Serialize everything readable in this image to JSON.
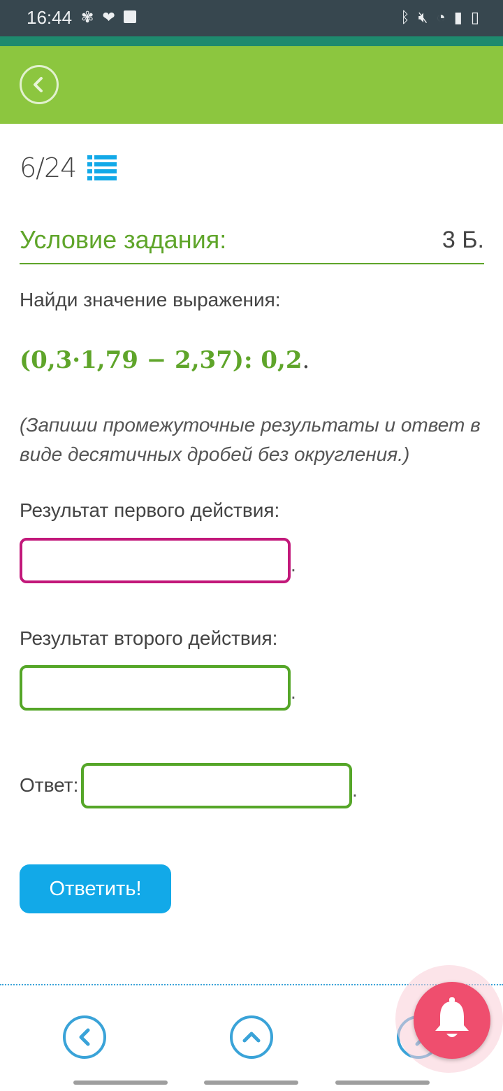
{
  "status_bar": {
    "time": "16:44",
    "left_icons": [
      "fan-icon",
      "heart-icon",
      "checkbox-icon"
    ],
    "right_icons": [
      "bluetooth-icon",
      "mute-icon",
      "wifi-icon",
      "signal-icon",
      "battery-icon"
    ]
  },
  "header": {
    "back_icon": "chevron-left-icon",
    "background": "#8cc63f"
  },
  "progress": {
    "counter": "6/24",
    "list_icon": "list-icon"
  },
  "task": {
    "title": "Условие задания:",
    "points": "3 Б.",
    "prompt": "Найди значение выражения:",
    "expression": "(0,3·1,79 − 2,37): 0,2",
    "expression_end": ".",
    "note": "(Запиши промежуточные результаты и ответ в виде десятичных дробей без округления.)",
    "step1_label": "Результат первого действия:",
    "step1_value": "",
    "step2_label": "Результат второго действия:",
    "step2_value": "",
    "answer_label": "Ответ:",
    "answer_value": "",
    "trailing_period": ".",
    "submit_label": "Ответить!"
  },
  "colors": {
    "accent_green": "#5fa52a",
    "pink_border": "#c2187a",
    "button_blue": "#12a9e8",
    "bell_red": "#ef4e6e"
  },
  "bottom_nav": {
    "prev_icon": "chevron-left-icon",
    "up_icon": "chevron-up-icon",
    "next_icon": "chevron-right-icon",
    "notification_icon": "bell-icon"
  }
}
